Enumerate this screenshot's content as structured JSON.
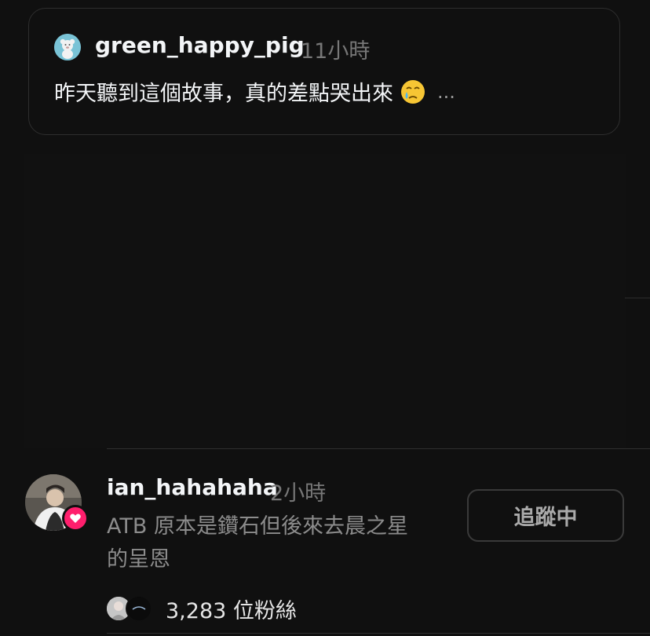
{
  "quoted_post": {
    "username": "green_happy_pig",
    "time": "11小時",
    "text": "昨天聽到這個故事，真的差點哭出來",
    "emoji": "holding-back-tears-emoji",
    "more": "..."
  },
  "profile": {
    "username": "ian_hahahaha",
    "time": "2小時",
    "bio_line1": "ATB 原本是鑽石但後來去晨之星",
    "bio_line2": "的呈恩",
    "follow_button": "追蹤中",
    "followers": "3,283 位粉絲",
    "badge_icon": "heart-icon"
  },
  "colors": {
    "background": "#101010",
    "badge": "#ff1f6d",
    "muted_text": "#777777"
  }
}
